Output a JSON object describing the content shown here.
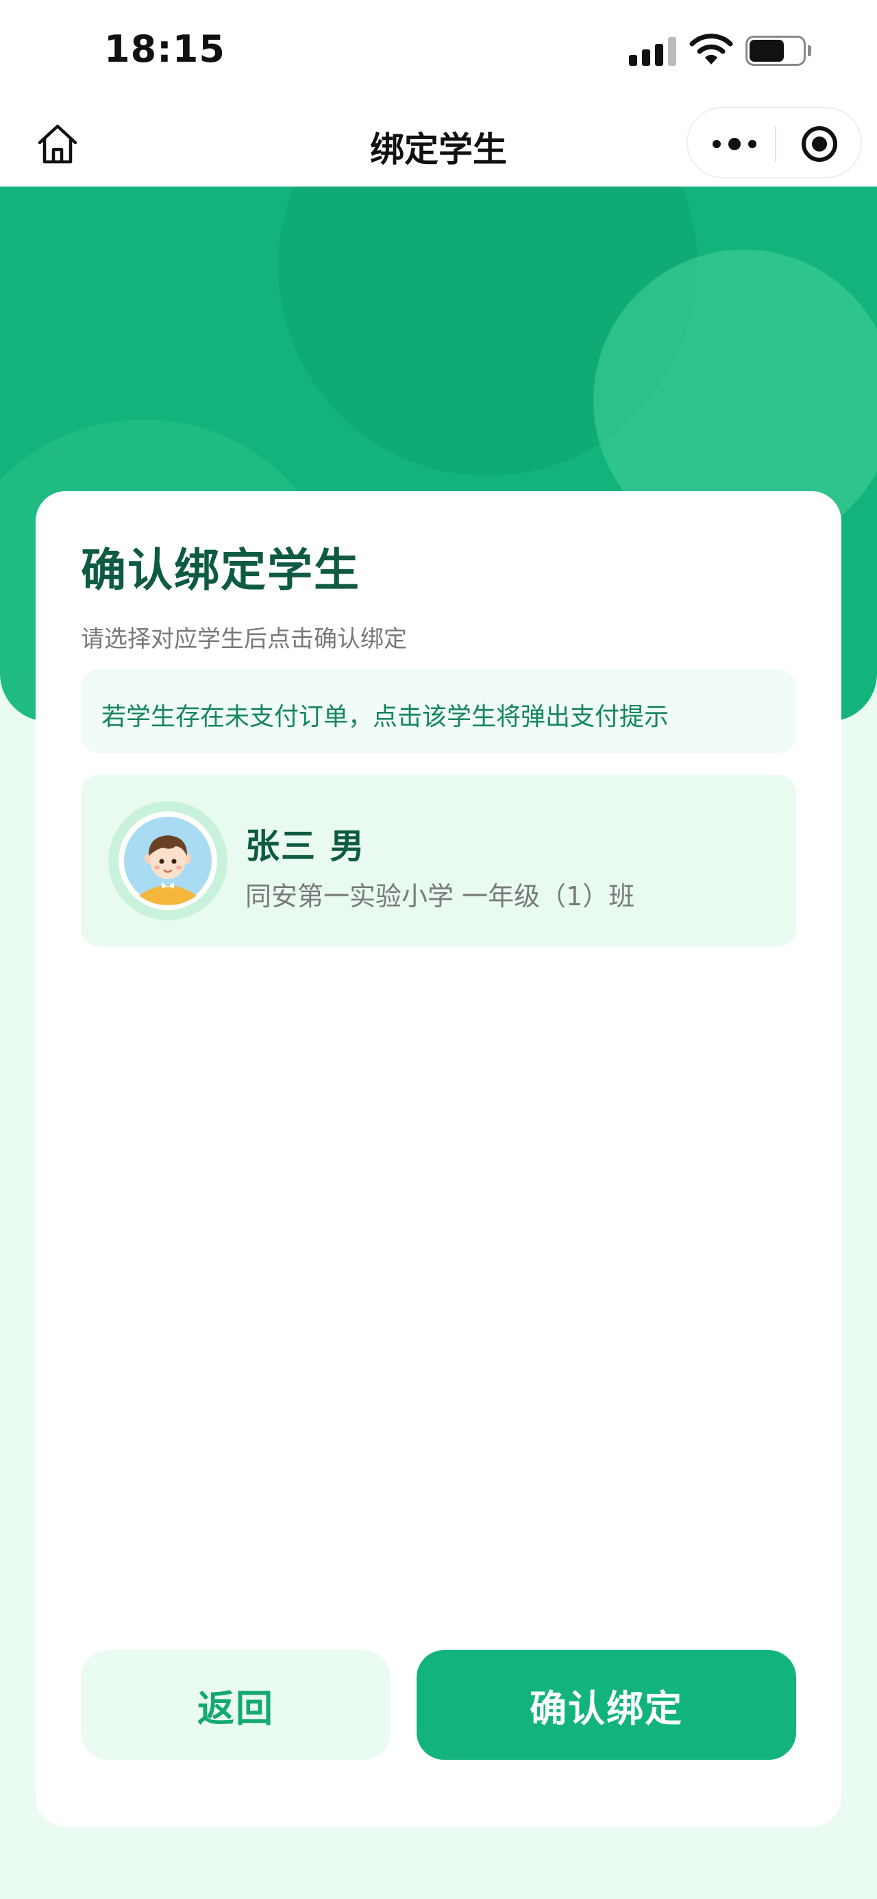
{
  "status_bar": {
    "time": "18:15"
  },
  "nav": {
    "title": "绑定学生",
    "home_icon": "home-icon",
    "more_icon": "more-dots-icon",
    "close_icon": "target-circle-icon"
  },
  "card": {
    "title": "确认绑定学生",
    "subtitle": "请选择对应学生后点击确认绑定",
    "notice": "若学生存在未支付订单，点击该学生将弹出支付提示"
  },
  "student": {
    "name_gender": "张三 男",
    "school_class": "同安第一实验小学 一年级（1）班",
    "avatar_icon": "boy-avatar-icon"
  },
  "buttons": {
    "back": "返回",
    "confirm": "确认绑定"
  },
  "colors": {
    "primary": "#12b47b",
    "title_green": "#0e5a43",
    "notice_text": "#14855f",
    "page_bg": "#eafbf2"
  }
}
